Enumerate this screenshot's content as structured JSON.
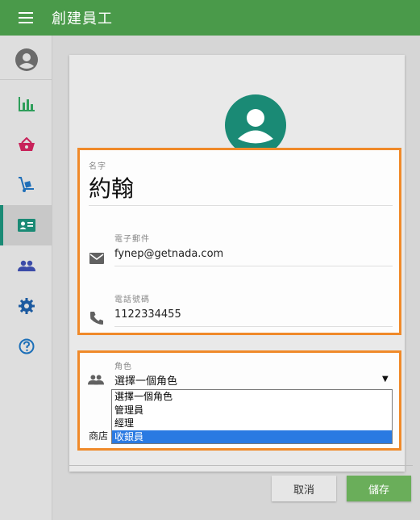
{
  "header": {
    "title": "創建員工"
  },
  "sidebar": {
    "items": [
      {
        "icon": "avatar-icon"
      },
      {
        "icon": "bar-chart-icon"
      },
      {
        "icon": "basket-icon"
      },
      {
        "icon": "hand-truck-icon"
      },
      {
        "icon": "id-card-icon",
        "active": true
      },
      {
        "icon": "people-icon"
      },
      {
        "icon": "gear-icon"
      },
      {
        "icon": "help-icon"
      }
    ]
  },
  "form": {
    "name": {
      "label": "名字",
      "value": "約翰"
    },
    "email": {
      "label": "電子郵件",
      "value": "fynep@getnada.com"
    },
    "phone": {
      "label": "電話號碼",
      "value": "1122334455"
    },
    "role": {
      "label": "角色",
      "value": "選擇一個角色",
      "options": [
        "選擇一個角色",
        "管理員",
        "經理",
        "收銀員"
      ],
      "highlighted_option": "收銀員"
    },
    "store": {
      "label": "商店"
    }
  },
  "actions": {
    "cancel_label": "取消",
    "save_label": "儲存"
  },
  "colors": {
    "appbar": "#4a9a4a",
    "accent": "#1a8a75",
    "highlight_border": "#f08a2a",
    "save_button": "#6aae5a",
    "dropdown_selected": "#2a7ae2"
  }
}
